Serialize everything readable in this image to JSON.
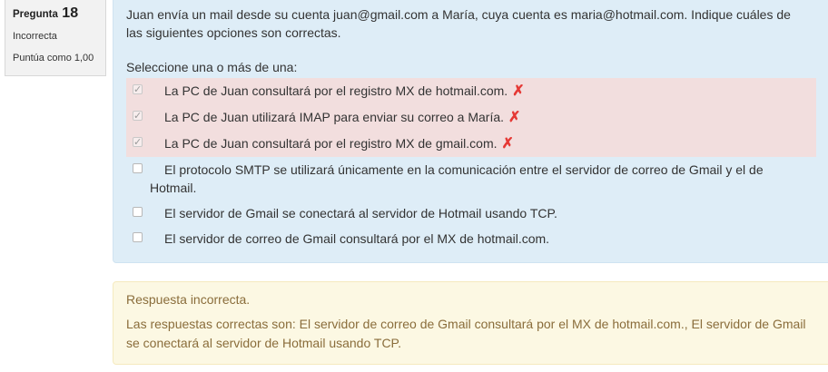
{
  "question_info": {
    "label": "Pregunta",
    "number": "18",
    "state": "Incorrecta",
    "grade": "Puntúa como 1,00"
  },
  "question": {
    "text": "Juan envía un mail desde su cuenta juan@gmail.com a María, cuya cuenta es maria@hotmail.com. Indique cuáles de las siguientes opciones son correctas.",
    "prompt": "Seleccione una o más de una:",
    "options": [
      {
        "label": "La PC de Juan consultará por el registro MX de hotmail.com.",
        "checked": true,
        "result": "incorrect"
      },
      {
        "label": "La PC de Juan utilizará IMAP para enviar su correo a María.",
        "checked": true,
        "result": "incorrect"
      },
      {
        "label": "La PC de Juan consultará por el registro MX de gmail.com.",
        "checked": true,
        "result": "incorrect"
      },
      {
        "label_line1": "El protocolo SMTP se utilizará únicamente en la comunicación entre el servidor de correo de Gmail y el de",
        "label_line2": "Hotmail.",
        "checked": false
      },
      {
        "label": "El servidor de Gmail se conectará al servidor de Hotmail usando TCP.",
        "checked": false
      },
      {
        "label": "El servidor de correo de Gmail consultará por el MX de hotmail.com.",
        "checked": false
      }
    ]
  },
  "feedback": {
    "title": "Respuesta incorrecta.",
    "right_answer": "Las respuestas correctas son: El servidor de correo de Gmail consultará por el MX de hotmail.com., El servidor de Gmail se conectará al servidor de Hotmail usando TCP."
  },
  "colors": {
    "formulation_bg": "#deedf7",
    "incorrect_bg": "#f2dede",
    "feedback_bg": "#fcf8e3",
    "feedback_text": "#8a6d3b",
    "incorrect_mark": "#e53935"
  },
  "icons": {
    "incorrect": "cross-icon",
    "checked": "checkmark-icon"
  }
}
